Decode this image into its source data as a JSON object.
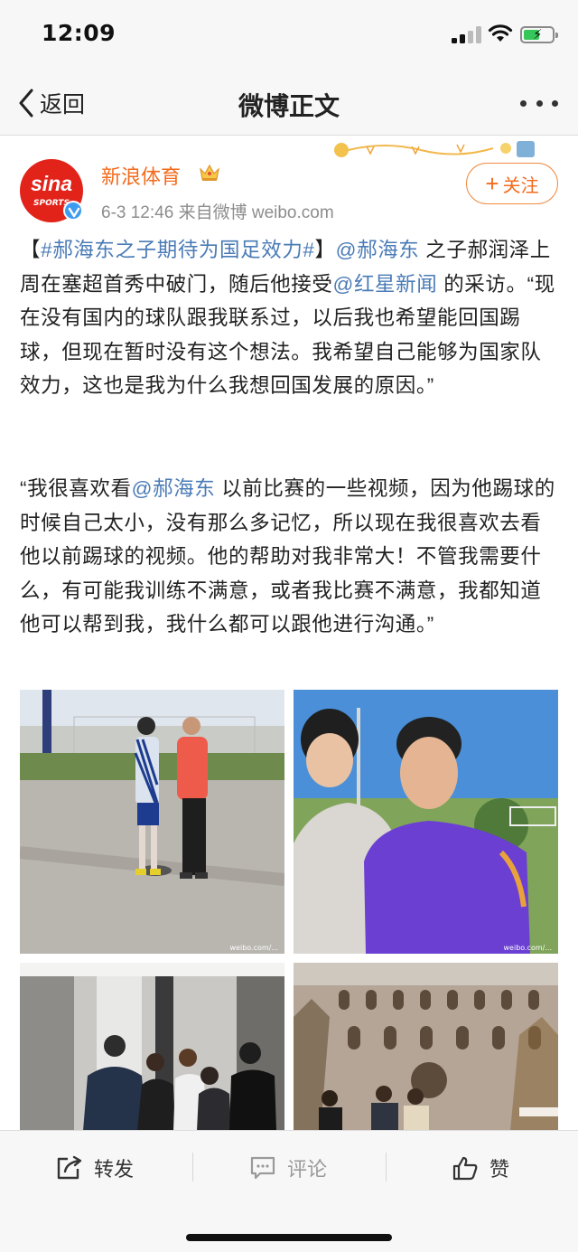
{
  "status_bar": {
    "time": "12:09",
    "battery_level": 0.55,
    "icons": [
      "cellular-signal-icon",
      "wifi-icon",
      "battery-charging-icon"
    ]
  },
  "nav": {
    "back_label": "返回",
    "title": "微博正文",
    "icons": [
      "chevron-left-icon",
      "more-dots-icon"
    ]
  },
  "post": {
    "author": {
      "name": "新浪体育",
      "avatar_text": "sina",
      "avatar_subtext": "SPORTS",
      "verified": true,
      "badge_icon": "crown-icon"
    },
    "meta": "6-3 12:46  来自微博 weibo.com",
    "follow_label": "关注",
    "paragraph1": [
      {
        "text": "【",
        "link": false
      },
      {
        "text": "#郝海东之子期待为国足效力#",
        "link": true
      },
      {
        "text": "】",
        "link": false
      },
      {
        "text": "@郝海东",
        "link": true
      },
      {
        "text": " 之子郝润泽上周在塞超首秀中破门，随后他接受",
        "link": false
      },
      {
        "text": "@红星新闻",
        "link": true
      },
      {
        "text": " 的采访。“现在没有国内的球队跟我联系过，以后我也希望能回国踢球，但现在暂时没有这个想法。我希望自己能够为国家队效力，这也是我为什么我想回国发展的原因。”",
        "link": false
      }
    ],
    "paragraph2": [
      {
        "text": "“我很喜欢看",
        "link": false
      },
      {
        "text": "@郝海东",
        "link": true
      },
      {
        "text": " 以前比赛的一些视频，因为他踢球的时候自己太小，没有那么多记忆，所以现在我很喜欢去看他以前踢球的视频。他的帮助对我非常大！不管我需要什么，有可能我训练不满意，或者我比赛不满意，我都知道他可以帮到我，我什么都可以跟他进行沟通。”",
        "link": false
      }
    ],
    "photos": [
      {
        "name": "photo-training-pitch",
        "watermark": "weibo.com/..."
      },
      {
        "name": "photo-father-son",
        "watermark": "weibo.com/..."
      },
      {
        "name": "photo-elevator-group",
        "watermark": ""
      },
      {
        "name": "photo-bullring-group",
        "watermark": ""
      }
    ]
  },
  "toolbar": {
    "repost_label": "转发",
    "comment_label": "评论",
    "like_label": "赞",
    "icons": [
      "share-icon",
      "comment-icon",
      "thumbs-up-icon"
    ]
  },
  "colors": {
    "link": "#4a7bb6",
    "brand": "#f26b1d",
    "sina_red": "#e2231a",
    "verified": "#3e9cf0"
  }
}
